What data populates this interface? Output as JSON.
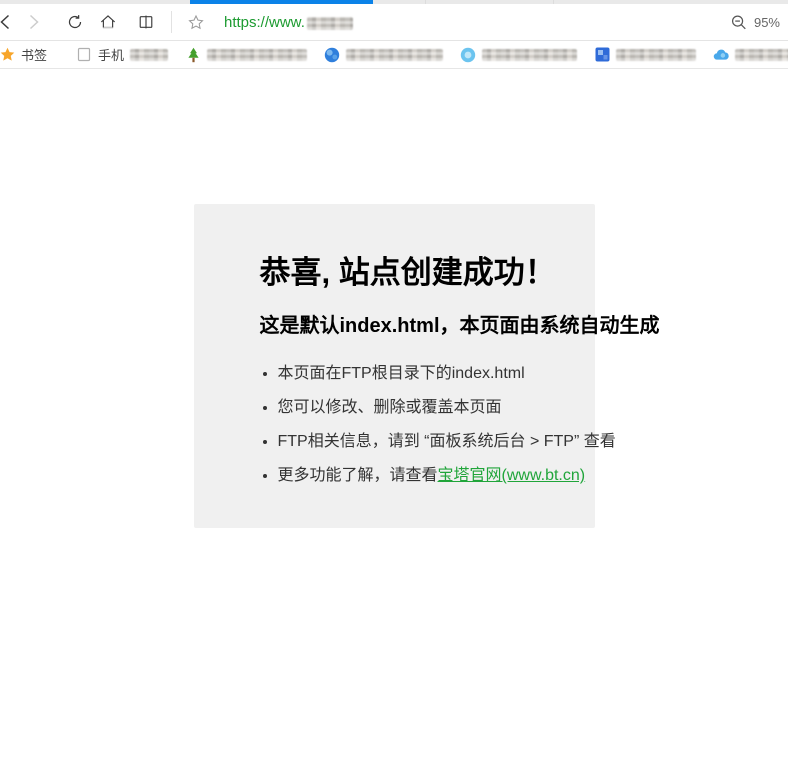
{
  "browser": {
    "tab_strip": {
      "loading_bar_color": "#0b82e8"
    },
    "toolbar": {
      "url_prefix": "https://www.",
      "url_domain": "[blurred]",
      "zoom_level": "95%"
    },
    "bookmarks_bar": {
      "items": [
        {
          "icon": "star-orange-icon",
          "label": "书签"
        },
        {
          "icon": "page-outline-icon",
          "label": "手机",
          "redacted_suffix": true
        },
        {
          "icon": "tree-icon",
          "redacted": true
        },
        {
          "icon": "globe-blue-icon",
          "redacted": true
        },
        {
          "icon": "circle-lightblue-icon",
          "redacted": true
        },
        {
          "icon": "square-blue-icon",
          "redacted": true
        },
        {
          "icon": "cloud-blue-icon",
          "redacted": true
        }
      ]
    }
  },
  "page": {
    "panel_bg": "#f0f0f0",
    "title": "恭喜, 站点创建成功！",
    "subtitle": "这是默认index.html，本页面由系统自动生成",
    "bullets": [
      "本页面在FTP根目录下的index.html",
      "您可以修改、删除或覆盖本页面",
      "FTP相关信息，请到 “面板系统后台 > FTP”  查看",
      {
        "prefix": "更多功能了解，请查看",
        "link_text": "宝塔官网(www.bt.cn)",
        "link_color": "#20a53a"
      }
    ]
  }
}
